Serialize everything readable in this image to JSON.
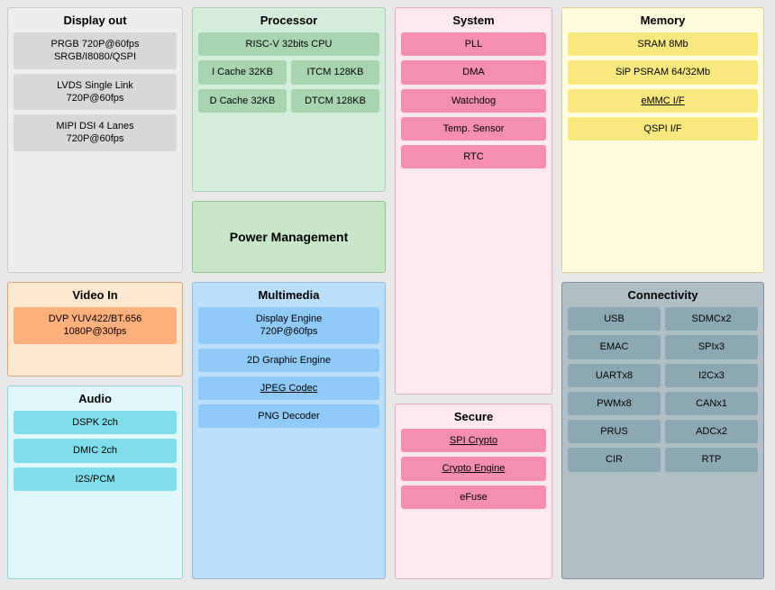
{
  "display_out": {
    "title": "Display out",
    "items": [
      {
        "text": "PRGB 720P@60fps\nSRGB/I8080/QSPI"
      },
      {
        "text": "LVDS Single Link\n720P@60fps"
      },
      {
        "text": "MIPI DSI 4 Lanes\n720P@60fps"
      }
    ]
  },
  "processor": {
    "title": "Processor",
    "cpu": "RISC-V 32bits CPU",
    "row1": {
      "left": "I Cache 32KB",
      "right": "ITCM 128KB"
    },
    "row2": {
      "left": "D Cache 32KB",
      "right": "DTCM 128KB"
    }
  },
  "memory": {
    "title": "Memory",
    "items": [
      {
        "text": "SRAM 8Mb",
        "underline": false
      },
      {
        "text": "SiP PSRAM 64/32Mb",
        "underline": false
      },
      {
        "text": "eMMC I/F",
        "underline": true
      },
      {
        "text": "QSPI  I/F",
        "underline": false
      }
    ]
  },
  "power_management": {
    "title": "Power Management"
  },
  "system": {
    "title": "System",
    "items": [
      "PLL",
      "DMA",
      "Watchdog",
      "Temp. Sensor",
      "RTC"
    ]
  },
  "connectivity": {
    "title": "Connectivity",
    "rows": [
      {
        "left": "USB",
        "right": "SDMCx2"
      },
      {
        "left": "EMAC",
        "right": "SPIx3"
      },
      {
        "left": "UARTx8",
        "right": "I2Cx3"
      },
      {
        "left": "PWMx8",
        "right": "CANx1"
      },
      {
        "left": "PRUS",
        "right": "ADCx2"
      },
      {
        "left": "CIR",
        "right": "RTP"
      }
    ]
  },
  "video_in": {
    "title": "Video In",
    "items": [
      {
        "text": "DVP YUV422/BT.656\n1080P@30fps"
      }
    ]
  },
  "audio": {
    "title": "Audio",
    "items": [
      "DSPK 2ch",
      "DMIC 2ch",
      "I2S/PCM"
    ]
  },
  "multimedia": {
    "title": "Multimedia",
    "items": [
      {
        "text": "Display Engine\n720P@60fps",
        "underline": false
      },
      {
        "text": "2D Graphic Engine",
        "underline": false
      },
      {
        "text": "JPEG Codec",
        "underline": true
      },
      {
        "text": "PNG Decoder",
        "underline": false
      }
    ]
  },
  "secure": {
    "title": "Secure",
    "items": [
      {
        "text": "SPI Crypto",
        "underline": true
      },
      {
        "text": "Crypto Engine",
        "underline": true
      },
      {
        "text": "eFuse",
        "underline": false
      }
    ]
  }
}
